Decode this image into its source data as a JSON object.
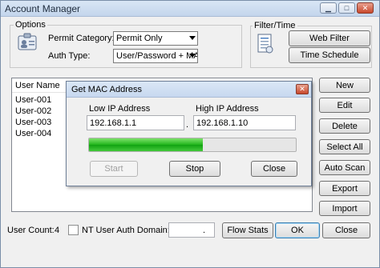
{
  "window": {
    "title": "Account Manager",
    "controls": {
      "minimize": "▁",
      "maximize": "□",
      "close": "✕"
    }
  },
  "options": {
    "label": "Options",
    "permit_category_label": "Permit Category:",
    "permit_category_value": "Permit Only",
    "auth_type_label": "Auth Type:",
    "auth_type_value": "User/Password + MAC"
  },
  "filter_time": {
    "label": "Filter/Time",
    "web_filter_button": "Web Filter",
    "time_schedule_button": "Time Schedule"
  },
  "user_list": {
    "column_header": "User Name",
    "users": [
      "User-001",
      "User-002",
      "User-003",
      "User-004"
    ]
  },
  "side_buttons": {
    "new": "New",
    "edit": "Edit",
    "delete": "Delete",
    "select_all": "Select All",
    "auto_scan": "Auto Scan",
    "export": "Export",
    "import": "Import"
  },
  "dialog": {
    "title": "Get MAC Address",
    "low_ip_label": "Low IP Address",
    "low_ip_value": "192.168.1.1",
    "separator": ".",
    "high_ip_label": "High IP Address",
    "high_ip_value": "192.168.1.10",
    "progress_fraction": 0.55,
    "start_button": "Start",
    "stop_button": "Stop",
    "close_button": "Close",
    "close_icon": "✕"
  },
  "bottom": {
    "user_count_label": "User Count:",
    "user_count_value": "4",
    "nt_auth_label": "NT User Auth Domain:",
    "nt_auth_checked": false,
    "domain_value": ".",
    "flow_stats_button": "Flow Stats",
    "ok_button": "OK",
    "close_button": "Close"
  },
  "colors": {
    "accent": "#3c7fb1",
    "progress": "#21b51b",
    "close_red": "#c8472b"
  }
}
